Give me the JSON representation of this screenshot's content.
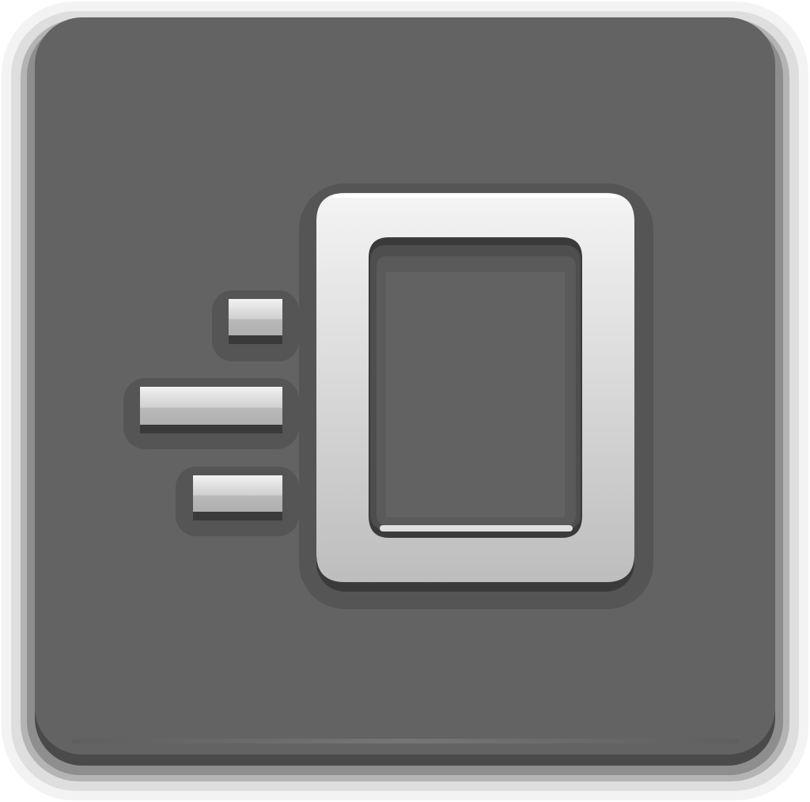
{
  "icon": {
    "name": "window-slide-in-icon",
    "colors": {
      "tile_face": "#636363",
      "tile_edge_dark": "#4a4a4a",
      "tile_rim_light": "#f2f2f2",
      "glyph_light": "#ececec",
      "glyph_mid": "#c4c4c4",
      "glyph_shadow": "#3a3a3a"
    }
  }
}
